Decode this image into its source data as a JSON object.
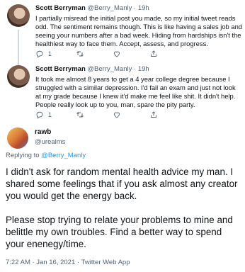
{
  "replies": [
    {
      "name": "Scott Berryman",
      "handle": "@Berry_Manly",
      "time": "19h",
      "text": "I partially misread the initial post you made, so my initial tweet reads odd. The sentiment remains though. This is like having a sales job and seeing your numbers after a bad week. Hiding from hardships isn't the healthiest way to face them. Accept, assess, and progress.",
      "reply_count": "1",
      "retweet_count": "",
      "like_count": "",
      "share_label": ""
    },
    {
      "name": "Scott Berryman",
      "handle": "@Berry_Manly",
      "time": "19h",
      "text": "It took me almost 8 years to get a 4 year college degree because I struggled with a similar depression. I'd fail an exam and just not look at my grade because I knew it'd make me feel like shit. It didn't help. People really look up to you, man, spare the pity party.",
      "reply_count": "1",
      "retweet_count": "",
      "like_count": "",
      "share_label": ""
    }
  ],
  "main": {
    "name": "rawb",
    "handle": "@urealms",
    "replying_prefix": "Replying to",
    "replying_to": "@Berry_Manly",
    "paragraphs": [
      "I didn't ask for random mental health advice my man. I shared some feelings that if you ask almost any creator you would get the energy back.",
      "Please stop trying to relate your problems to mine and belittle my own troubles. Find a better way to spend your enenegy/time."
    ],
    "timestamp": "7:22 AM · Jan 16, 2021 · Twitter Web App"
  },
  "separator": "·",
  "icons": [
    "reply-icon",
    "retweet-icon",
    "like-icon",
    "share-icon"
  ],
  "colors": {
    "link": "#1d9bf0",
    "muted": "#536471",
    "text": "#0f1419",
    "thread_line": "#cfd9de"
  }
}
